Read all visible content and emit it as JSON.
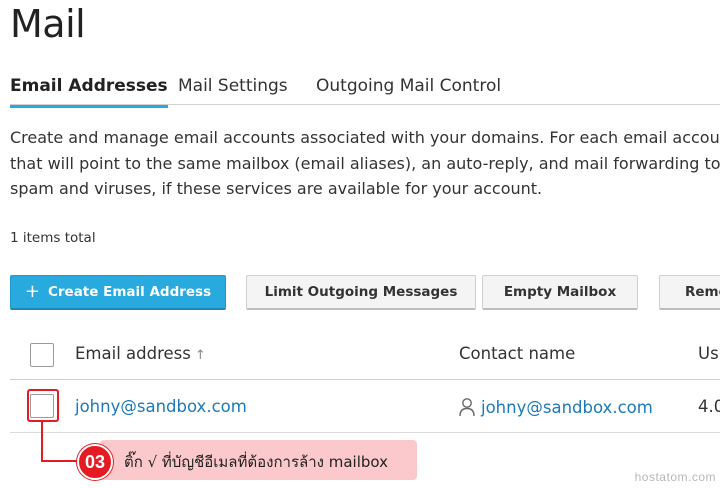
{
  "page": {
    "title": "Mail"
  },
  "tabs": [
    {
      "label": "Email Addresses",
      "active": true
    },
    {
      "label": "Mail Settings",
      "active": false
    },
    {
      "label": "Outgoing Mail Control",
      "active": false
    }
  ],
  "description": {
    "line1": "Create and manage email accounts associated with your domains. For each email accou",
    "line2": "that will point to the same mailbox (email aliases), an auto-reply, and mail forwarding to",
    "line3": "spam and viruses, if these services are available for your account."
  },
  "list": {
    "items_total": "1 items total"
  },
  "toolbar": {
    "create_icon": "+",
    "create_label": "Create Email Address",
    "limit_label": "Limit Outgoing Messages",
    "empty_label": "Empty Mailbox",
    "remove_label": "Remo"
  },
  "table": {
    "columns": {
      "email": "Email address",
      "email_sort_icon": "↑",
      "contact": "Contact name",
      "usage": "Us"
    },
    "rows": [
      {
        "email": "johny@sandbox.com",
        "contact": "johny@sandbox.com",
        "usage": "4.0"
      }
    ]
  },
  "annotation": {
    "badge": "03",
    "text": "ติ๊ก √ ที่บัญชีอีเมลที่ต้องการล้าง mailbox",
    "color": "#e51b24"
  },
  "watermark": "hostatom.com",
  "colors": {
    "accent": "#28aade",
    "link": "#1c7ab8",
    "annotation": "#e51b24",
    "annotation_bg": "#fbc9cb"
  }
}
